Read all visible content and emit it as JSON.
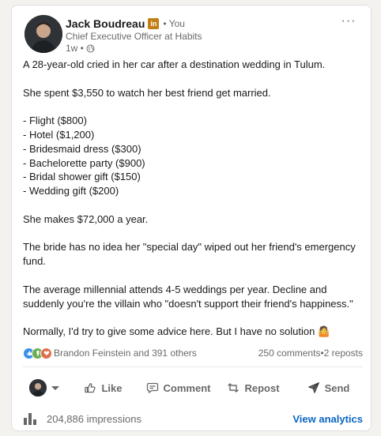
{
  "author": {
    "name": "Jack Boudreau",
    "badge": "in",
    "you_label": "• You",
    "headline": "Chief Executive Officer at Habits",
    "time": "1w •"
  },
  "more_label": "···",
  "post": {
    "paragraphs": [
      [
        "A 28-year-old cried in her car after a destination wedding in Tulum."
      ],
      [
        "She spent $3,550 to watch her best friend get married."
      ],
      [
        "- Flight ($800)",
        "- Hotel ($1,200)",
        "- Bridesmaid dress ($300)",
        "- Bachelorette party ($900)",
        "- Bridal shower gift ($150)",
        "- Wedding gift ($200)"
      ],
      [
        "She makes $72,000 a year."
      ],
      [
        "The bride has no idea her \"special day\" wiped out her friend's emergency fund."
      ],
      [
        "The average millennial attends 4-5 weddings per year. Decline and suddenly you're the villain who \"doesn't support their friend's happiness.\""
      ],
      [
        "Normally, I'd try to give some advice here. But I have no solution 🤷"
      ]
    ]
  },
  "social": {
    "reactors": "Brandon Feinstein and 391 others",
    "comments": "250 comments",
    "separator": " • ",
    "reposts": "2 reposts"
  },
  "actions": {
    "like": "Like",
    "comment": "Comment",
    "repost": "Repost",
    "send": "Send"
  },
  "analytics": {
    "impressions": "204,886 impressions",
    "view_label": "View analytics"
  },
  "colors": {
    "link_blue": "#0a66c2",
    "badge_gold": "#c37d16"
  }
}
